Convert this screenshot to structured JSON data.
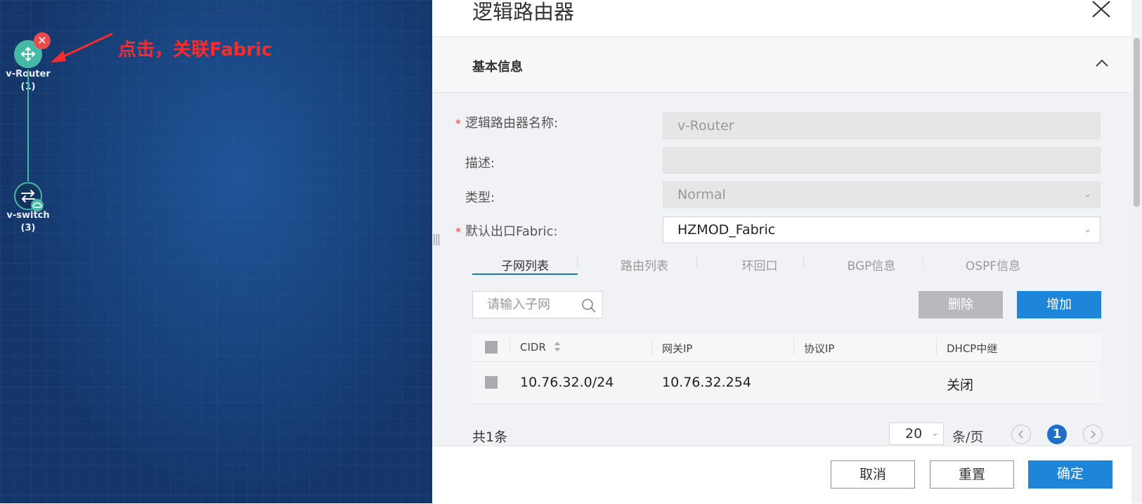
{
  "canvas": {
    "router": {
      "label": "v-Router",
      "count": "(1)"
    },
    "switch": {
      "label": "v-switch",
      "count": "(3)"
    },
    "delete_badge": "✕",
    "annotation": "点击，关联Fabric",
    "annotation_color": "#ff2a2a",
    "node_color": "#45b9a4"
  },
  "dialog": {
    "title": "逻辑路由器",
    "section_title": "基本信息",
    "fields": {
      "name_label": "逻辑路由器名称:",
      "name_value": "v-Router",
      "desc_label": "描述:",
      "desc_value": "",
      "type_label": "类型:",
      "type_value": "Normal",
      "fabric_label": "默认出口Fabric:",
      "fabric_value": "HZMOD_Fabric",
      "required_mark": "*"
    },
    "tabs": [
      "子网列表",
      "路由列表",
      "环回口",
      "BGP信息",
      "OSPF信息"
    ],
    "active_tab": 0,
    "toolbar": {
      "search_placeholder": "请输入子网",
      "delete_label": "删除",
      "add_label": "增加"
    },
    "table": {
      "columns": [
        "CIDR",
        "网关IP",
        "协议IP",
        "DHCP中继"
      ],
      "rows": [
        {
          "cidr": "10.76.32.0/24",
          "gateway": "10.76.32.254",
          "protocol_ip": "",
          "dhcp": "关闭"
        }
      ]
    },
    "pagination": {
      "total": "共1条",
      "page_size": "20",
      "per_page": "条/页",
      "current_page": "1"
    },
    "footer": {
      "cancel": "取消",
      "reset": "重置",
      "confirm": "确定"
    },
    "accent_color": "#1e86d9"
  }
}
